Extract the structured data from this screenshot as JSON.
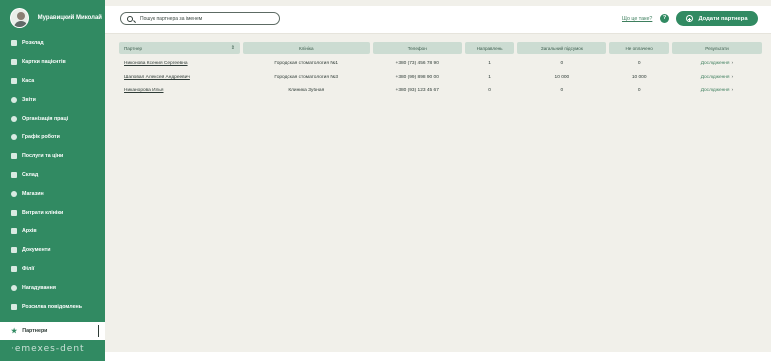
{
  "user": {
    "name": "Муравицкий Миколай"
  },
  "sidebar": {
    "items": [
      {
        "label": "Розклад",
        "icon": "calendar-icon"
      },
      {
        "label": "Картки пацієнтів",
        "icon": "patient-cards-icon"
      },
      {
        "label": "Каса",
        "icon": "cash-icon"
      },
      {
        "label": "Звіти",
        "icon": "reports-icon"
      },
      {
        "label": "Організація праці",
        "icon": "work-organization-icon"
      },
      {
        "label": "Графік роботи",
        "icon": "schedule-icon"
      },
      {
        "label": "Послуги та ціни",
        "icon": "services-icon"
      },
      {
        "label": "Склад",
        "icon": "warehouse-icon"
      },
      {
        "label": "Магазин",
        "icon": "shop-icon"
      },
      {
        "label": "Витрати клініки",
        "icon": "expenses-icon"
      },
      {
        "label": "Архів",
        "icon": "archive-icon"
      },
      {
        "label": "Документи",
        "icon": "documents-icon"
      },
      {
        "label": "Філії",
        "icon": "branches-icon"
      },
      {
        "label": "Нагадування",
        "icon": "reminders-icon"
      },
      {
        "label": "Розсилка повідомлень",
        "icon": "mailing-icon"
      }
    ],
    "active": {
      "label": "Партнери",
      "icon": "star-icon"
    },
    "brand": "emexes-dent"
  },
  "header": {
    "search_placeholder": "Пошук партнера за іменем",
    "what_link": "Що це таке?",
    "help_icon": "?",
    "add_button": "Додати партнера"
  },
  "table": {
    "columns": [
      "Партнер",
      "Клініка",
      "Телефон",
      "Направлень",
      "Загальний підсумок",
      "Не оплачено",
      "Результати"
    ],
    "rows": [
      {
        "partner": "Никонова Ксения Сергеевна",
        "clinic": "Городская стоматология №1",
        "phone": "+380 (73) 456 78 90",
        "referrals": "1",
        "total": "0",
        "unpaid": "0",
        "result": "Дослідження"
      },
      {
        "partner": "Шаповал Алексей Андреевич",
        "clinic": "Городская стоматология №3",
        "phone": "+380 (99) 898 90 00",
        "referrals": "1",
        "total": "10 000",
        "unpaid": "10 000",
        "result": "Дослідження"
      },
      {
        "partner": "Никанорова Илья",
        "clinic": "Клиника Зубная",
        "phone": "+380 (93) 123 45 67",
        "referrals": "0",
        "total": "0",
        "unpaid": "0",
        "result": "Дослідження"
      }
    ]
  },
  "colors": {
    "primary": "#318a62",
    "background": "#f1f0ea",
    "header_cell": "#ccdcd2"
  }
}
